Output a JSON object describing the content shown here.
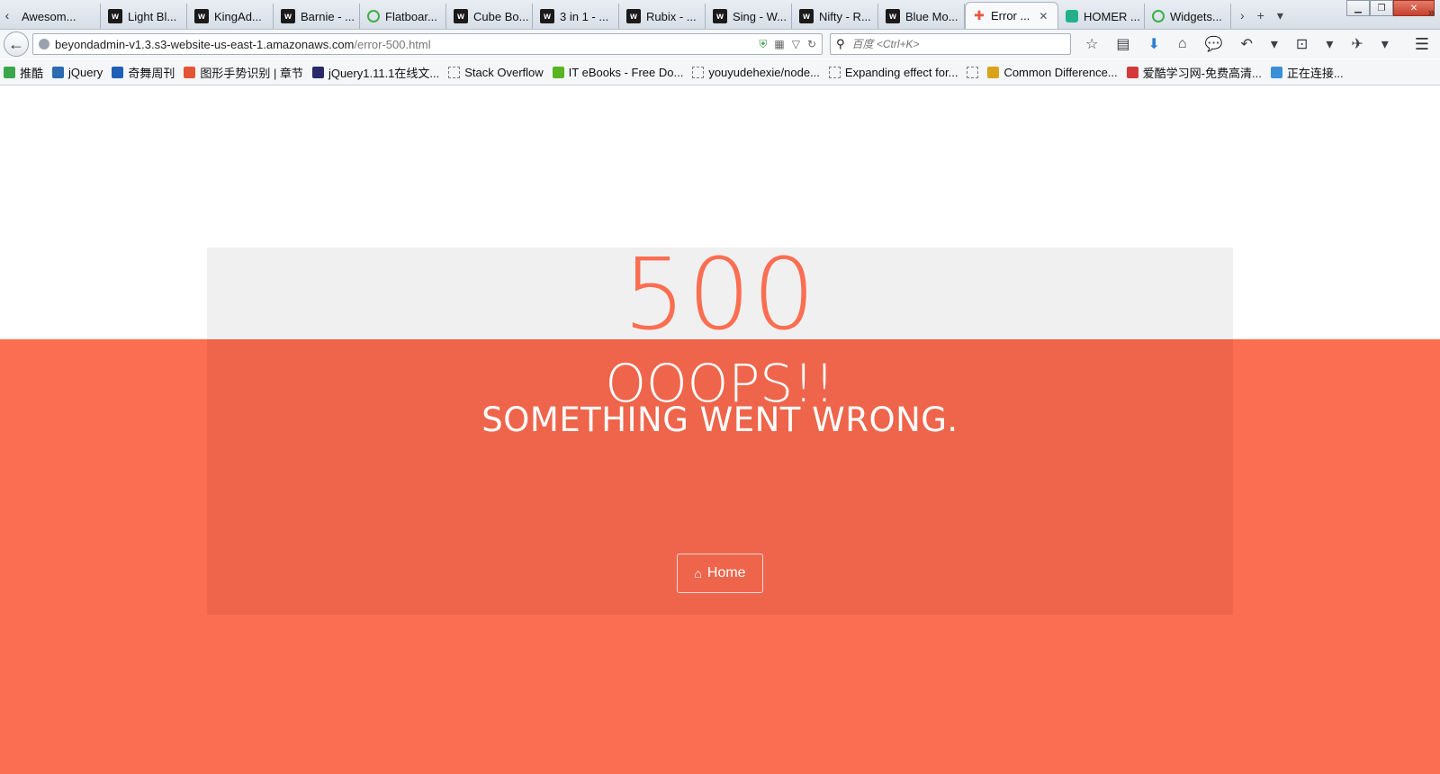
{
  "browser": {
    "tabs": [
      {
        "label": "Awesom...",
        "icon": "none-icon"
      },
      {
        "label": "Light Bl...",
        "icon": "w-logo-icon"
      },
      {
        "label": "KingAd...",
        "icon": "w-logo-icon"
      },
      {
        "label": "Barnie - ...",
        "icon": "w-logo-icon"
      },
      {
        "label": "Flatboar...",
        "icon": "green-ring-icon"
      },
      {
        "label": "Cube Bo...",
        "icon": "w-logo-icon"
      },
      {
        "label": "3 in 1 - ...",
        "icon": "w-logo-icon"
      },
      {
        "label": "Rubix - ...",
        "icon": "w-logo-icon"
      },
      {
        "label": "Sing - W...",
        "icon": "w-logo-icon"
      },
      {
        "label": "Nifty - R...",
        "icon": "w-logo-icon"
      },
      {
        "label": "Blue Mo...",
        "icon": "w-logo-icon"
      },
      {
        "label": "Error ...",
        "icon": "error-icon",
        "active": true
      },
      {
        "label": "HOMER ...",
        "icon": "teal-square-icon"
      },
      {
        "label": "Widgets...",
        "icon": "green-ring-icon"
      }
    ],
    "address": {
      "host": "beyondadmin-v1.3.s3-website-us-east-1.amazonaws.com",
      "path": "/error-500.html"
    },
    "search": {
      "placeholder": "百度 <Ctrl+K>"
    },
    "bookmarks": [
      {
        "label": "推酷",
        "color": "#3aa84a"
      },
      {
        "label": "jQuery",
        "color": "#2b6cb0"
      },
      {
        "label": "奇舞周刊",
        "color": "#1e5fb5"
      },
      {
        "label": "图形手势识别 | 章节",
        "color": "#e35533"
      },
      {
        "label": "jQuery1.11.1在线文...",
        "color": "#2a2a6a"
      },
      {
        "label": "Stack Overflow",
        "color": "dash"
      },
      {
        "label": "IT eBooks - Free Do...",
        "color": "#58b41f"
      },
      {
        "label": "youyudehexie/node...",
        "color": "dash"
      },
      {
        "label": "Expanding effect for...",
        "color": "dash"
      },
      {
        "label": "",
        "color": "dash"
      },
      {
        "label": "Common Difference...",
        "color": "#d9a21b"
      },
      {
        "label": "爱酷学习网-免费高清...",
        "color": "#d43a3a"
      },
      {
        "label": "正在连接...",
        "color": "#3a8fd6"
      }
    ]
  },
  "page": {
    "error_code": "500",
    "title": "OOOPS!!",
    "subtitle": "SOMETHING WENT WRONG.",
    "home_button": "Home"
  }
}
